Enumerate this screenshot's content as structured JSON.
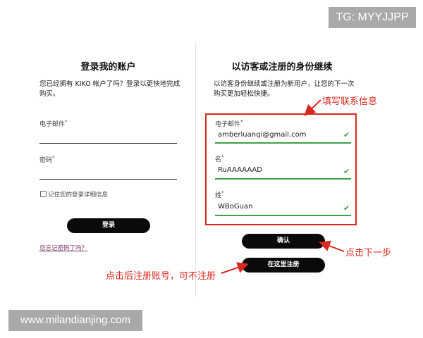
{
  "watermarks": {
    "top_right": "TG: MYYJJPP",
    "bottom_left": "www.milandianjing.com"
  },
  "login": {
    "title": "登录我的账户",
    "desc_line1": "您已经拥有 KIKO 帐户了吗？登录以更快地完成",
    "desc_line2": "购买。",
    "email_label": "电子邮件",
    "password_label": "密码",
    "required_mark": "*",
    "remember_label": "记住您的登录详细信息",
    "login_button": "登录",
    "forgot_link": "您忘记密码了吗？"
  },
  "guest": {
    "title": "以访客或注册的身份继续",
    "desc_line1": "以访客身份继续或注册为新用户，让您的下一次",
    "desc_line2": "购买更加轻松快捷。",
    "fields": [
      {
        "label": "电子邮件",
        "value": "amberluanqi@gmail.com"
      },
      {
        "label": "名",
        "value": "RuAAAAAAD"
      },
      {
        "label": "姓",
        "value": "WBoGuan"
      }
    ],
    "required_mark": "*",
    "confirm_button": "确认",
    "register_button": "在这里注册"
  },
  "annotations": {
    "fill_contact": "填写联系信息",
    "click_next": "点击下一步",
    "register_optional": "点击后注册账号，可不注册"
  },
  "colors": {
    "annotation": "#d9281e",
    "valid": "#3fa244",
    "button": "#0a0a0a"
  },
  "icons": {
    "valid": "check-icon"
  }
}
